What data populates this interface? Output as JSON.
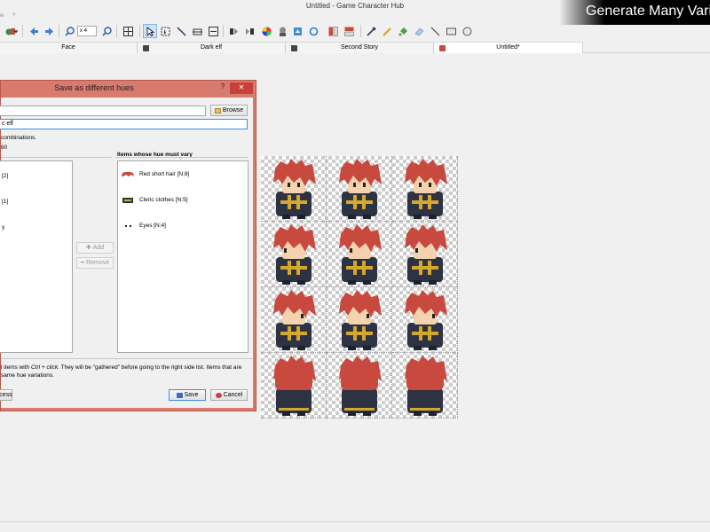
{
  "window": {
    "title": "Untitled - Game Character Hub"
  },
  "banner": {
    "text": "Generate Many Vari"
  },
  "menu": {
    "items": [
      "w",
      "?"
    ]
  },
  "toolbar": {
    "zoom": "x 4"
  },
  "tabs": [
    {
      "label": "Face"
    },
    {
      "label": "Dark elf"
    },
    {
      "label": "Second Story"
    },
    {
      "label": "Untitled*"
    }
  ],
  "dialog": {
    "title": "Save as different hues",
    "help": "?",
    "close": "✕",
    "browse_label": "Browse",
    "path_value": "",
    "name_value": "c elf",
    "combinations_text": "combinations.",
    "count_text": "60",
    "right_header": "Items whose hue must vary",
    "left_items": [
      "[2]",
      "[1]",
      "y"
    ],
    "right_items": [
      {
        "label": "Red short hair [N:8]",
        "icon": "hair-icon"
      },
      {
        "label": "Cleric clothes [N:5]",
        "icon": "clothes-icon"
      },
      {
        "label": "Eyes [N:4]",
        "icon": "eyes-icon"
      }
    ],
    "add_label": "Add",
    "remove_label": "Remove",
    "help_line1_a": "l items with ",
    "help_line1_em": "Ctrl + click",
    "help_line1_b": ". They will be \"gathered\" before going to the right side list. Items that are",
    "help_line2": "same hue variations.",
    "access_label": "cess",
    "save_label": "Save",
    "cancel_label": "Cancel"
  },
  "colors": {
    "dialog_frame": "#d87a6e",
    "close_button": "#c7403a",
    "hair": "#c84a3e",
    "clothes": "#2e3344",
    "trim": "#d4a82a"
  }
}
